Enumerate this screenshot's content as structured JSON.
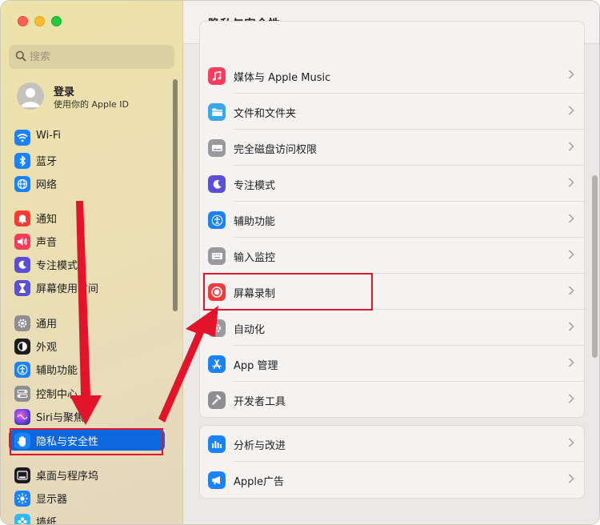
{
  "window": {
    "title": "隐私与安全性"
  },
  "sidebar": {
    "search_placeholder": "搜索",
    "account": {
      "title": "登录",
      "subtitle": "使用你的 Apple ID"
    },
    "items": [
      {
        "label": "Wi-Fi",
        "icon": "wifi-icon",
        "color": "#1a82fb"
      },
      {
        "label": "蓝牙",
        "icon": "bluetooth-icon",
        "color": "#1a82fb"
      },
      {
        "label": "网络",
        "icon": "globe-icon",
        "color": "#1a82fb"
      },
      {
        "label": "通知",
        "icon": "bell-icon",
        "color": "#f43d37"
      },
      {
        "label": "声音",
        "icon": "speaker-icon",
        "color": "#f43d57"
      },
      {
        "label": "专注模式",
        "icon": "moon-icon",
        "color": "#5b4fd6"
      },
      {
        "label": "屏幕使用时间",
        "icon": "hourglass-icon",
        "color": "#5b4fd6"
      },
      {
        "label": "通用",
        "icon": "gear-icon",
        "color": "#8e8e93"
      },
      {
        "label": "外观",
        "icon": "appearance-icon",
        "color": "#1c1c1e"
      },
      {
        "label": "辅助功能",
        "icon": "accessibility-icon",
        "color": "#1a82fb"
      },
      {
        "label": "控制中心",
        "icon": "control-center-icon",
        "color": "#8e8e93"
      },
      {
        "label": "Siri与聚焦",
        "icon": "siri-icon",
        "color": "#6f3fd8"
      },
      {
        "label": "隐私与安全性",
        "icon": "hand-icon",
        "color": "#1a82fb",
        "selected": true
      },
      {
        "label": "桌面与程序坞",
        "icon": "dock-icon",
        "color": "#1c1c1e"
      },
      {
        "label": "显示器",
        "icon": "sun-icon",
        "color": "#1a82fb"
      },
      {
        "label": "墙纸",
        "icon": "wallpaper-icon",
        "color": "#2fb8f2"
      }
    ]
  },
  "main": {
    "title": "隐私与安全性",
    "groups": [
      {
        "rows": [
          {
            "label": "媒体与 Apple Music",
            "icon": "music-note-icon",
            "color": "#fb3c5a"
          },
          {
            "label": "文件和文件夹",
            "icon": "folder-icon",
            "color": "#39a7ee"
          },
          {
            "label": "完全磁盘访问权限",
            "icon": "disk-icon",
            "color": "#9a9a9e"
          },
          {
            "label": "专注模式",
            "icon": "moon-icon",
            "color": "#5b4fd6"
          },
          {
            "label": "辅助功能",
            "icon": "accessibility-icon",
            "color": "#1a82fb"
          },
          {
            "label": "输入监控",
            "icon": "keyboard-icon",
            "color": "#9a9a9e"
          },
          {
            "label": "屏幕录制",
            "icon": "record-icon",
            "color": "#f23a3a"
          },
          {
            "label": "自动化",
            "icon": "automation-icon",
            "color": "#9a9a9e"
          },
          {
            "label": "App 管理",
            "icon": "app-store-icon",
            "color": "#1a82fb"
          },
          {
            "label": "开发者工具",
            "icon": "hammer-icon",
            "color": "#8e8e93"
          }
        ]
      },
      {
        "rows": [
          {
            "label": "分析与改进",
            "icon": "analytics-icon",
            "color": "#1a82fb"
          },
          {
            "label": "Apple广告",
            "icon": "megaphone-icon",
            "color": "#1a82fb"
          }
        ]
      }
    ]
  },
  "annotations": {
    "highlight_color": "#e3142a"
  }
}
